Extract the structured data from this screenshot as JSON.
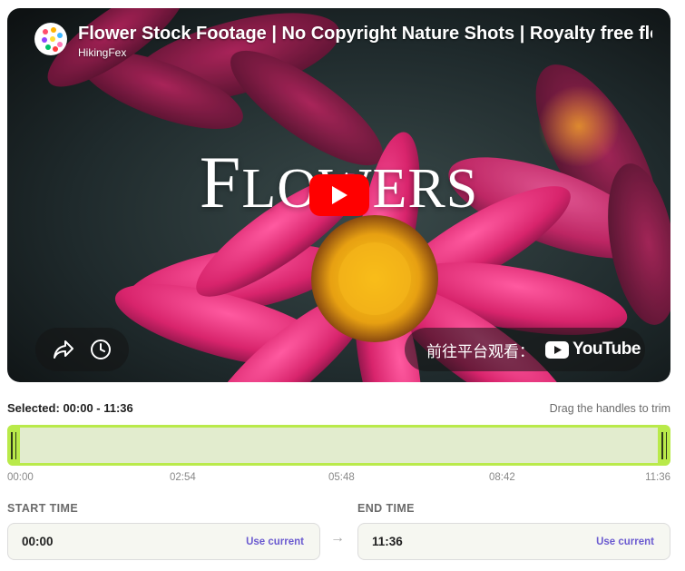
{
  "video": {
    "title": "Flower Stock Footage | No Copyright Nature Shots | Royalty free flowers",
    "channel": "HikingFex",
    "overlay_first": "F",
    "overlay_rest": "LOWERS",
    "watch_on_label": "前往平台观看：",
    "youtube_wordmark": "YouTube",
    "play_icon": "play-icon",
    "share_icon": "share-icon",
    "watch_later_icon": "clock-icon"
  },
  "trim": {
    "selected_label": "Selected:",
    "selected_range": "00:00 - 11:36",
    "hint": "Drag the handles to trim",
    "ticks": [
      "00:00",
      "02:54",
      "05:48",
      "08:42",
      "11:36"
    ],
    "selection_start_fraction": 0.0,
    "selection_end_fraction": 1.0
  },
  "start": {
    "label": "START TIME",
    "value": "00:00",
    "action": "Use current"
  },
  "end": {
    "label": "END TIME",
    "value": "11:36",
    "action": "Use current"
  },
  "arrow": "→",
  "colors": {
    "accent_green": "#b9ea4a",
    "track_fill": "#e2ecce",
    "link_purple": "#6b5bd0",
    "youtube_red": "#ff0000"
  }
}
